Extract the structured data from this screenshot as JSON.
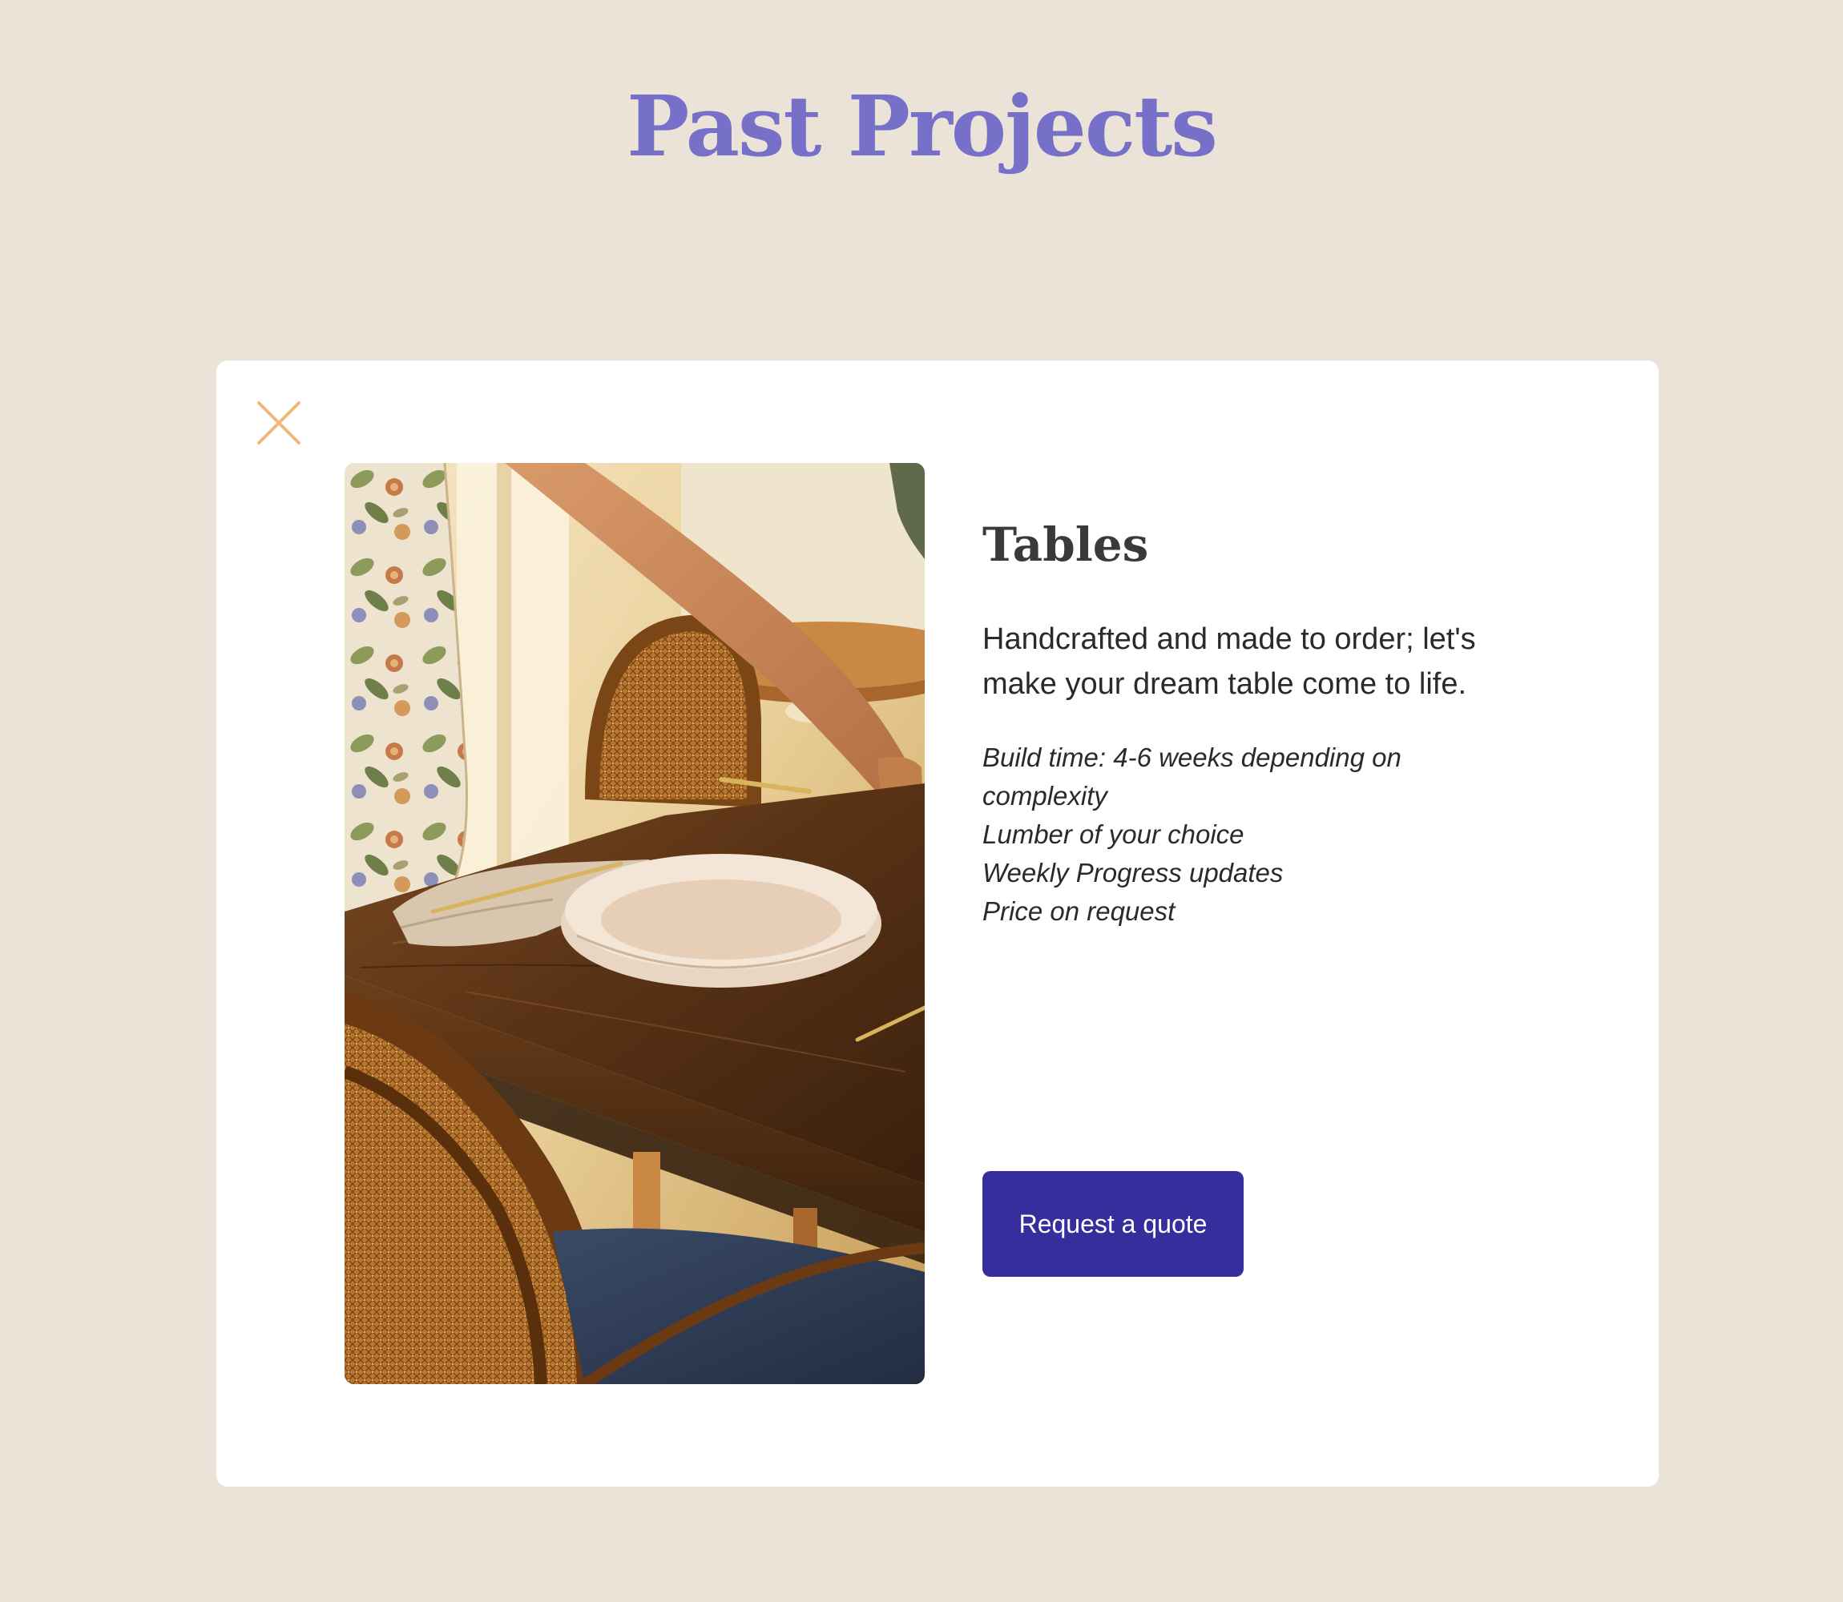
{
  "page": {
    "title": "Past Projects"
  },
  "modal": {
    "close_icon": "close-icon",
    "image_alt": "Walnut dining table set with a white dish, linen napkin, gold cutlery and cane-back chairs",
    "title": "Tables",
    "description": "Handcrafted and made to order; let's make your dream table come to life.",
    "specs": [
      "Build time: 4-6 weeks depending on complexity",
      "Lumber of your choice",
      "Weekly Progress updates",
      "Price on request"
    ],
    "cta_label": "Request a quote"
  },
  "colors": {
    "background": "#ebe3d7",
    "title": "#7770c9",
    "close_icon": "#f0b97a",
    "button": "#372e9e",
    "heading": "#3b3a38"
  }
}
